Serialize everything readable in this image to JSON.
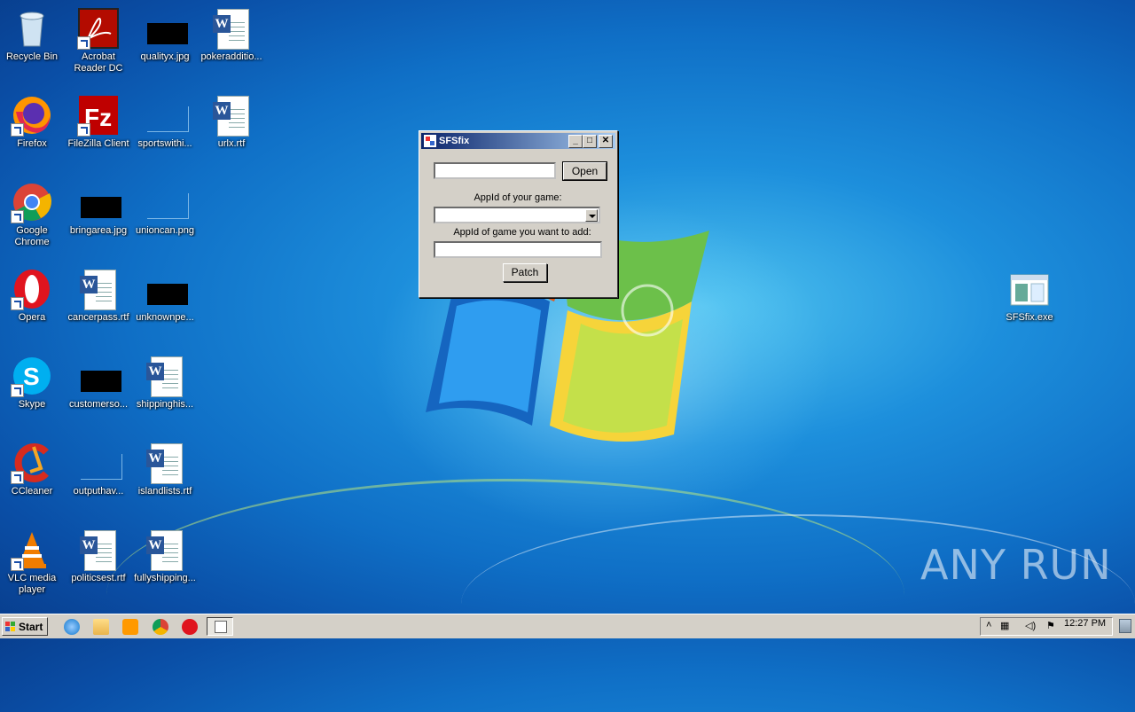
{
  "desktop": {
    "icons": [
      {
        "label": "Recycle Bin"
      },
      {
        "label": "Acrobat Reader DC"
      },
      {
        "label": "qualityx.jpg"
      },
      {
        "label": "pokeradditio..."
      },
      {
        "label": "Firefox"
      },
      {
        "label": "FileZilla Client"
      },
      {
        "label": "sportswithi..."
      },
      {
        "label": "urlx.rtf"
      },
      {
        "label": "Google Chrome"
      },
      {
        "label": "bringarea.jpg"
      },
      {
        "label": "unioncan.png"
      },
      {
        "label": "Opera"
      },
      {
        "label": "cancerpass.rtf"
      },
      {
        "label": "unknownpe..."
      },
      {
        "label": "Skype"
      },
      {
        "label": "customerso..."
      },
      {
        "label": "shippinghis..."
      },
      {
        "label": "CCleaner"
      },
      {
        "label": "outputhav..."
      },
      {
        "label": "islandlists.rtf"
      },
      {
        "label": "VLC media player"
      },
      {
        "label": "politicsest.rtf"
      },
      {
        "label": "fullyshipping..."
      },
      {
        "label": "SFSfix.exe"
      }
    ]
  },
  "window": {
    "title": "SFSfix",
    "path_value": "",
    "open_label": "Open",
    "appid_label": "AppId of your game:",
    "appid_selected": "",
    "add_label": "AppId of game you want to add:",
    "add_value": "",
    "patch_label": "Patch"
  },
  "taskbar": {
    "start_label": "Start",
    "clock": "12:27 PM"
  },
  "watermark": "ANY RUN",
  "colors": {
    "title_gradient_start": "#0a246a",
    "title_gradient_end": "#a6caf0",
    "chrome": "#d4d0c8"
  }
}
